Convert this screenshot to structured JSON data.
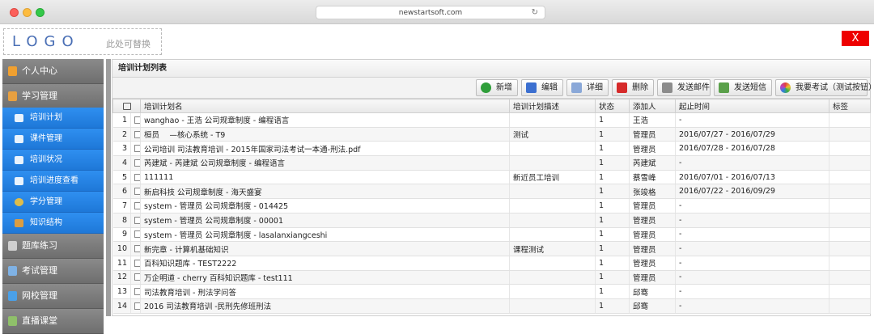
{
  "browser": {
    "url": "newstartsoft.com"
  },
  "header": {
    "logo": "LOGO",
    "logo_sub": "此处可替换",
    "close_label": "X"
  },
  "sidebar": {
    "groups": [
      {
        "label": "个人中心",
        "icon": "person-icon",
        "color": "#f0a030"
      },
      {
        "label": "学习管理",
        "icon": "book-icon",
        "color": "#e8a040"
      },
      {
        "label": "题库练习",
        "icon": "database-icon",
        "color": "#cfcfcf"
      },
      {
        "label": "考试管理",
        "icon": "exam-icon",
        "color": "#7fb2e5"
      },
      {
        "label": "网校管理",
        "icon": "monitor-icon",
        "color": "#4aa0e8"
      },
      {
        "label": "直播课堂",
        "icon": "live-icon",
        "color": "#8fc06a"
      }
    ],
    "sub_items": [
      {
        "label": "培训计划",
        "icon": "plan-icon"
      },
      {
        "label": "课件管理",
        "icon": "courseware-icon"
      },
      {
        "label": "培训状况",
        "icon": "status-icon"
      },
      {
        "label": "培训进度查看",
        "icon": "progress-icon"
      },
      {
        "label": "学分管理",
        "icon": "credit-icon"
      },
      {
        "label": "知识结构",
        "icon": "structure-icon"
      }
    ]
  },
  "main": {
    "title": "培训计划列表",
    "toolbar": {
      "buttons": [
        {
          "label": "新增",
          "icon": "add-icon",
          "color": "#2f9e3a"
        },
        {
          "label": "编辑",
          "icon": "edit-icon",
          "color": "#3b6fd0"
        },
        {
          "label": "详细",
          "icon": "detail-icon",
          "color": "#8aa8d8"
        },
        {
          "label": "删除",
          "icon": "delete-icon",
          "color": "#d62a2a"
        },
        {
          "label": "发送邮件",
          "icon": "email-icon",
          "color": "#8c8c8c"
        },
        {
          "label": "发送短信",
          "icon": "sms-icon",
          "color": "#5aa04a"
        },
        {
          "label": "我要考试（测试按钮）",
          "icon": "exam-color-icon",
          "color": "#e06aa8"
        }
      ]
    },
    "table": {
      "columns": [
        "培训计划名",
        "培训计划描述",
        "状态",
        "添加人",
        "起止时间",
        "标签"
      ],
      "rows": [
        {
          "n": "1",
          "name": "wanghao - 王浩 公司规章制度 - 编程语言",
          "desc": "",
          "status": "1",
          "by": "王浩",
          "period": "-",
          "tag": ""
        },
        {
          "n": "2",
          "name": "桓员　 —核心系统 - T9",
          "desc": "测试",
          "status": "1",
          "by": "管理员",
          "period": "2016/07/27 - 2016/07/29",
          "tag": ""
        },
        {
          "n": "3",
          "name": "公司培训 司法教育培训 - 2015年国家司法考试一本通-刑法.pdf",
          "desc": "",
          "status": "1",
          "by": "管理员",
          "period": "2016/07/28 - 2016/07/28",
          "tag": ""
        },
        {
          "n": "4",
          "name": "芮建斌 - 芮建斌 公司规章制度 - 编程语言",
          "desc": "",
          "status": "1",
          "by": "芮建斌",
          "period": "-",
          "tag": ""
        },
        {
          "n": "5",
          "name": "111111",
          "desc": "新近员工培训",
          "status": "1",
          "by": "蔡雪峰",
          "period": "2016/07/01 - 2016/07/13",
          "tag": ""
        },
        {
          "n": "6",
          "name": "新启科技 公司规章制度 - 海天盛宴",
          "desc": "",
          "status": "1",
          "by": "张竣格",
          "period": "2016/07/22 - 2016/09/29",
          "tag": ""
        },
        {
          "n": "7",
          "name": "system - 管理员 公司规章制度 - 014425",
          "desc": "",
          "status": "1",
          "by": "管理员",
          "period": "-",
          "tag": ""
        },
        {
          "n": "8",
          "name": "system - 管理员 公司规章制度 - 00001",
          "desc": "",
          "status": "1",
          "by": "管理员",
          "period": "-",
          "tag": ""
        },
        {
          "n": "9",
          "name": "system - 管理员 公司规章制度 - lasalanxiangceshi",
          "desc": "",
          "status": "1",
          "by": "管理员",
          "period": "-",
          "tag": ""
        },
        {
          "n": "10",
          "name": "新完章 - 计算机基础知识",
          "desc": "课程测试",
          "status": "1",
          "by": "管理员",
          "period": "-",
          "tag": ""
        },
        {
          "n": "11",
          "name": "百科知识题库 - TEST2222",
          "desc": "",
          "status": "1",
          "by": "管理员",
          "period": "-",
          "tag": ""
        },
        {
          "n": "12",
          "name": "万企明道 - cherry 百科知识题库 - test111",
          "desc": "",
          "status": "1",
          "by": "管理员",
          "period": "-",
          "tag": ""
        },
        {
          "n": "13",
          "name": "司法教育培训 - 刑法学问答",
          "desc": "",
          "status": "1",
          "by": "邱骞",
          "period": "-",
          "tag": ""
        },
        {
          "n": "14",
          "name": "2016 司法教育培训 -民刑先修班刑法",
          "desc": "",
          "status": "1",
          "by": "邱骞",
          "period": "-",
          "tag": ""
        }
      ]
    }
  }
}
